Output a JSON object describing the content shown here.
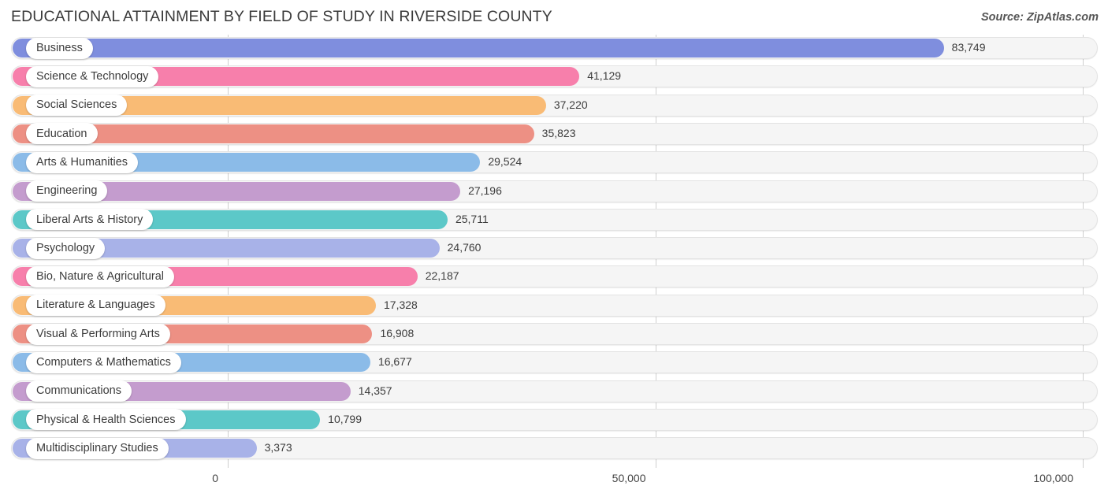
{
  "header": {
    "title": "EDUCATIONAL ATTAINMENT BY FIELD OF STUDY IN RIVERSIDE COUNTY",
    "source": "Source: ZipAtlas.com"
  },
  "chart_data": {
    "type": "bar",
    "orientation": "horizontal",
    "title": "EDUCATIONAL ATTAINMENT BY FIELD OF STUDY IN RIVERSIDE COUNTY",
    "subtitle": "",
    "xlabel": "",
    "ylabel": "",
    "xlim": [
      0,
      100000
    ],
    "grid": true,
    "legend": null,
    "tick_labels": [
      "0",
      "50,000",
      "100,000"
    ],
    "tick_values": [
      0,
      50000,
      100000
    ],
    "categories": [
      "Business",
      "Science & Technology",
      "Social Sciences",
      "Education",
      "Arts & Humanities",
      "Engineering",
      "Liberal Arts & History",
      "Psychology",
      "Bio, Nature & Agricultural",
      "Literature & Languages",
      "Visual & Performing Arts",
      "Computers & Mathematics",
      "Communications",
      "Physical & Health Sciences",
      "Multidisciplinary Studies"
    ],
    "values": [
      83749,
      41129,
      37220,
      35823,
      29524,
      27196,
      25711,
      24760,
      22187,
      17328,
      16908,
      16677,
      14357,
      10799,
      3373
    ],
    "value_labels": [
      "83,749",
      "41,129",
      "37,220",
      "35,823",
      "29,524",
      "27,196",
      "25,711",
      "24,760",
      "22,187",
      "17,328",
      "16,908",
      "16,677",
      "14,357",
      "10,799",
      "3,373"
    ],
    "colors": [
      "#7f8ede",
      "#f77fab",
      "#f9bb75",
      "#ed9084",
      "#8bbbe8",
      "#c49cce",
      "#5cc8c8",
      "#a8b2e8",
      "#f77fab",
      "#f9bb75",
      "#ed9084",
      "#8bbbe8",
      "#c49cce",
      "#5cc8c8",
      "#a8b2e8"
    ],
    "track_color": "#f5f5f5",
    "gridline_color": "#cfcfcf"
  }
}
